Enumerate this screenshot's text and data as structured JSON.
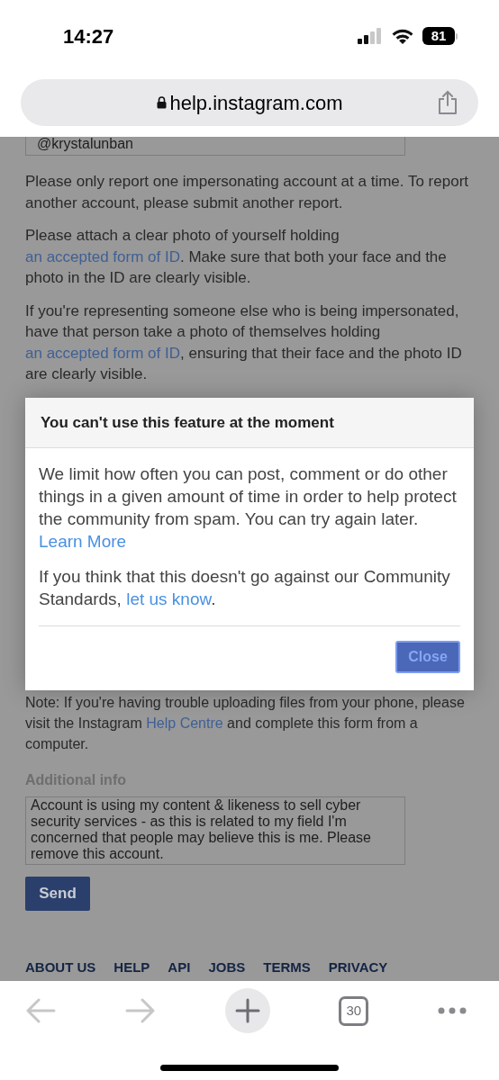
{
  "status_bar": {
    "time": "14:27",
    "battery": "81"
  },
  "address_bar": {
    "url": "help.instagram.com"
  },
  "page": {
    "username_field": {
      "value": "@krystalunban"
    },
    "paragraphs": [
      [
        {
          "kind": "text",
          "text": "Please only report one impersonating account at a time. To report another account, please submit another report."
        }
      ],
      [
        {
          "kind": "text",
          "text": "Please attach a clear photo of yourself holding "
        },
        {
          "kind": "link",
          "text": "an accepted form of ID"
        },
        {
          "kind": "text",
          "text": ". Make sure that both your face and the photo in the ID are clearly visible."
        }
      ],
      [
        {
          "kind": "text",
          "text": "If you're representing someone else who is being impersonated, have that person take a photo of themselves holding "
        },
        {
          "kind": "link",
          "text": "an accepted form of ID"
        },
        {
          "kind": "text",
          "text": ", ensuring that their face and the photo ID are clearly visible."
        }
      ]
    ],
    "note": [
      {
        "kind": "text",
        "text": "Note: If you're having trouble uploading files from your phone, please visit the Instagram "
      },
      {
        "kind": "link",
        "text": "Help Centre"
      },
      {
        "kind": "text",
        "text": " and complete this form from a computer."
      }
    ],
    "additional_info": {
      "label": "Additional info",
      "value": "Account is using my content & likeness to sell cyber security services - as this is related to my field I'm concerned that people may believe this is me. Please remove this account."
    },
    "send_button": "Send",
    "footer_links": [
      "ABOUT US",
      "HELP",
      "API",
      "JOBS",
      "TERMS",
      "PRIVACY"
    ]
  },
  "modal": {
    "title": "You can't use this feature at the moment",
    "paragraphs": [
      [
        {
          "kind": "text",
          "text": "We limit how often you can post, comment or do other things in a given amount of time in order to help protect the community from spam. You can try again later. "
        },
        {
          "kind": "link",
          "text": "Learn More"
        }
      ],
      [
        {
          "kind": "text",
          "text": "If you think that this doesn't go against our Community Standards, "
        },
        {
          "kind": "link",
          "text": "let us know"
        },
        {
          "kind": "text",
          "text": "."
        }
      ]
    ],
    "close_button": "Close"
  },
  "toolbar": {
    "tab_count": "30"
  }
}
